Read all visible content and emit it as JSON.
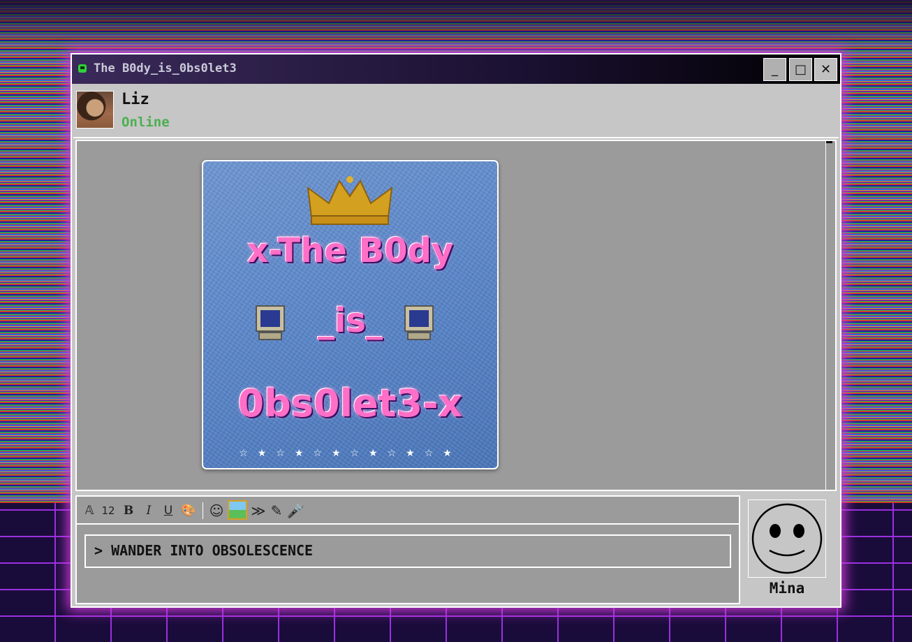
{
  "window": {
    "title": "The B0dy_is_0bs0let3",
    "minimize_label": "_",
    "maximize_label": "□",
    "close_label": "✕"
  },
  "contact": {
    "name": "Liz",
    "status": "Online",
    "status_color": "#4caf50"
  },
  "message": {
    "artwork_lines": [
      "x-The B0dy",
      "_is_",
      "0bs0let3-x"
    ],
    "artwork_stars": "☆★☆★☆★☆★☆★☆★"
  },
  "toolbar": {
    "font_icon": "𝔸",
    "size_label": "12",
    "bold_label": "B",
    "italic_label": "I",
    "underline_label": "U",
    "color_icon": "🎨",
    "emoji_icon": "☺",
    "forward_icon": "≫",
    "pencil_icon": "✎",
    "mic_icon": "🎤"
  },
  "composer": {
    "text": "> WANDER INTO OBSOLESCENCE"
  },
  "user": {
    "name": "Mina"
  },
  "colors": {
    "accent_glow": "#d43ae0",
    "window_bg": "#c6c6c6",
    "panel_bg": "#9b9b9b"
  }
}
